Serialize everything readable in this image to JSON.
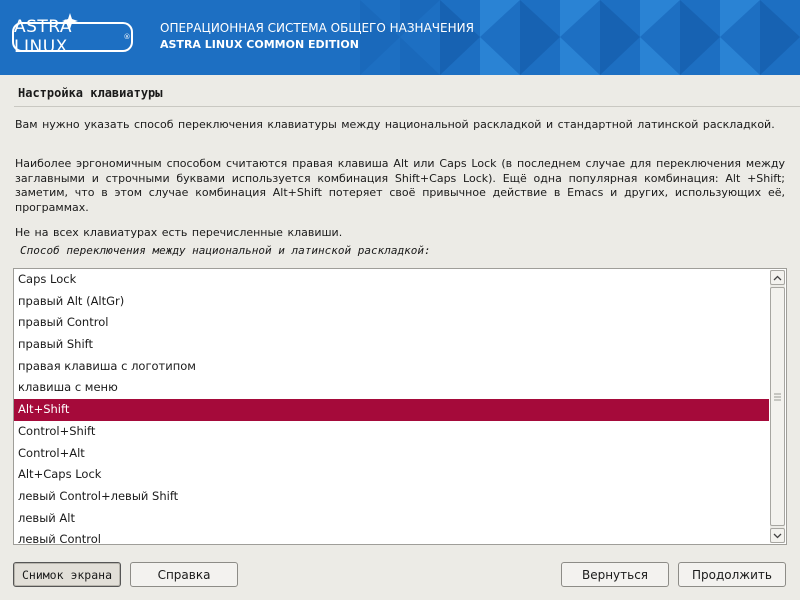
{
  "header": {
    "logo_text": "ASTRA LINUX",
    "logo_mark": "®",
    "title_line1": "ОПЕРАЦИОННАЯ СИСТЕМА ОБЩЕГО НАЗНАЧЕНИЯ",
    "title_line2": "ASTRA LINUX COMMON EDITION",
    "colors": {
      "banner": "#1e73c7",
      "banner_dark": "#1565b3",
      "banner_light": "#2e86d6"
    }
  },
  "page": {
    "heading": "Настройка клавиатуры",
    "paragraph1": "Вам нужно указать способ переключения клавиатуры между национальной раскладкой и стандартной латинской раскладкой.",
    "paragraph2": "Наиболее эргономичным способом считаются правая клавиша Alt или Caps Lock (в последнем случае для переключения между заглавными и строчными буквами используется комбинация Shift+Caps Lock). Ещё одна популярная комбинация: Alt +Shift; заметим, что в этом случае комбинация Alt+Shift потеряет своё привычное действие в Emacs и других, использующих её, программах.",
    "paragraph3": "Не на всех клавиатурах есть перечисленные клавиши.",
    "prompt": "Способ переключения между национальной и латинской раскладкой:"
  },
  "options": {
    "items": [
      "Caps Lock",
      "правый Alt (AltGr)",
      "правый Control",
      "правый Shift",
      "правая клавиша с логотипом",
      "клавиша с меню",
      "Alt+Shift",
      "Control+Shift",
      "Control+Alt",
      "Alt+Caps Lock",
      "левый Control+левый Shift",
      "левый Alt",
      "левый Control"
    ],
    "selected": "Alt+Shift",
    "selection_color": "#a50a3a"
  },
  "buttons": {
    "screenshot": "Снимок экрана",
    "help": "Справка",
    "back": "Вернуться",
    "continue": "Продолжить"
  }
}
